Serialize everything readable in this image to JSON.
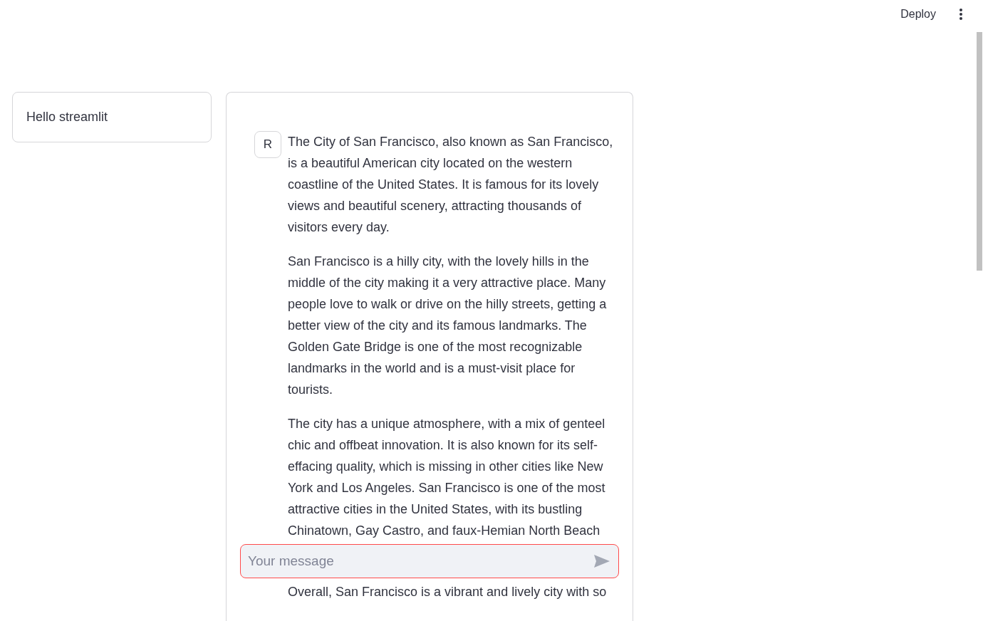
{
  "header": {
    "deploy_label": "Deploy"
  },
  "sidebar_card": {
    "text": "Hello streamlit"
  },
  "chat": {
    "messages": [
      {
        "avatar": "R",
        "paragraphs": [
          "The City of San Francisco, also known as San Francisco, is a beautiful American city located on the western coastline of the United States. It is famous for its lovely views and beautiful scenery, attracting thousands of visitors every day.",
          "San Francisco is a hilly city, with the lovely hills in the middle of the city making it a very attractive place. Many people love to walk or drive on the hilly streets, getting a better view of the city and its famous landmarks. The Golden Gate Bridge is one of the most recognizable landmarks in the world and is a must-visit place for tourists.",
          "The city has a unique atmosphere, with a mix of genteel chic and offbeat innovation. It is also known for its self-effacing quality, which is missing in other cities like New York and Los Angeles. San Francisco is one of the most attractive cities in the United States, with its bustling Chinatown, Gay Castro, and faux-Hemian North Beach"
        ]
      }
    ],
    "input": {
      "placeholder": "Your message",
      "focused": true
    },
    "trailing_paragraph": "Overall, San Francisco is a vibrant and lively city with so"
  }
}
